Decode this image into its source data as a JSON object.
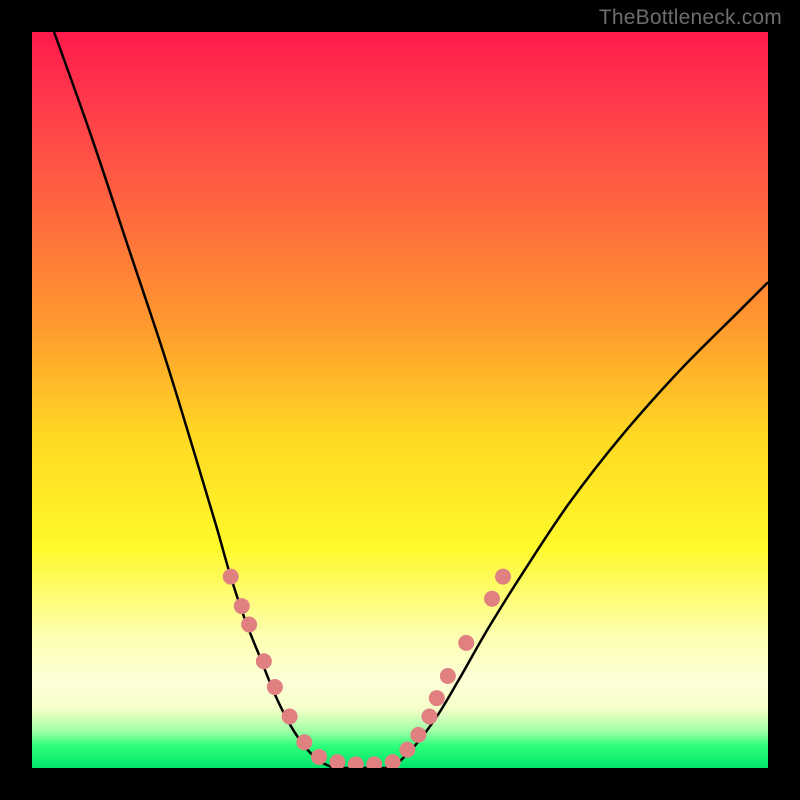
{
  "watermark": "TheBottleneck.com",
  "chart_data": {
    "type": "line",
    "title": "",
    "xlabel": "",
    "ylabel": "",
    "xlim": [
      0,
      100
    ],
    "ylim": [
      0,
      100
    ],
    "background_gradient": {
      "top_color": "#ff1a4b",
      "mid_color": "#fff92a",
      "bottom_color": "#00e46a",
      "note": "vertical red-to-yellow-to-green gradient indicating bottleneck severity; green = optimal"
    },
    "series": [
      {
        "name": "bottleneck-curve-left",
        "stroke": "#000000",
        "x": [
          3,
          8,
          13,
          18,
          22,
          25,
          27,
          29,
          31,
          33,
          35,
          37,
          39,
          41
        ],
        "y": [
          100,
          86,
          71,
          56,
          43,
          33,
          26,
          20,
          15,
          10,
          6,
          3,
          1,
          0
        ]
      },
      {
        "name": "bottleneck-curve-valley",
        "stroke": "#000000",
        "x": [
          41,
          43,
          45,
          47,
          49
        ],
        "y": [
          0,
          0,
          0,
          0,
          0
        ]
      },
      {
        "name": "bottleneck-curve-right",
        "stroke": "#000000",
        "x": [
          49,
          52,
          55,
          58,
          62,
          67,
          73,
          80,
          88,
          96,
          100
        ],
        "y": [
          0,
          3,
          7,
          12,
          19,
          27,
          36,
          45,
          54,
          62,
          66
        ]
      }
    ],
    "markers": {
      "name": "highlight-dots",
      "color": "#e08080",
      "radius_px": 8,
      "points": [
        {
          "x": 27.0,
          "y": 26.0
        },
        {
          "x": 28.5,
          "y": 22.0
        },
        {
          "x": 29.5,
          "y": 19.5
        },
        {
          "x": 31.5,
          "y": 14.5
        },
        {
          "x": 33.0,
          "y": 11.0
        },
        {
          "x": 35.0,
          "y": 7.0
        },
        {
          "x": 37.0,
          "y": 3.5
        },
        {
          "x": 39.0,
          "y": 1.5
        },
        {
          "x": 41.5,
          "y": 0.8
        },
        {
          "x": 44.0,
          "y": 0.5
        },
        {
          "x": 46.5,
          "y": 0.5
        },
        {
          "x": 49.0,
          "y": 0.8
        },
        {
          "x": 51.0,
          "y": 2.5
        },
        {
          "x": 52.5,
          "y": 4.5
        },
        {
          "x": 54.0,
          "y": 7.0
        },
        {
          "x": 55.0,
          "y": 9.5
        },
        {
          "x": 56.5,
          "y": 12.5
        },
        {
          "x": 59.0,
          "y": 17.0
        },
        {
          "x": 62.5,
          "y": 23.0
        },
        {
          "x": 64.0,
          "y": 26.0
        }
      ]
    }
  }
}
